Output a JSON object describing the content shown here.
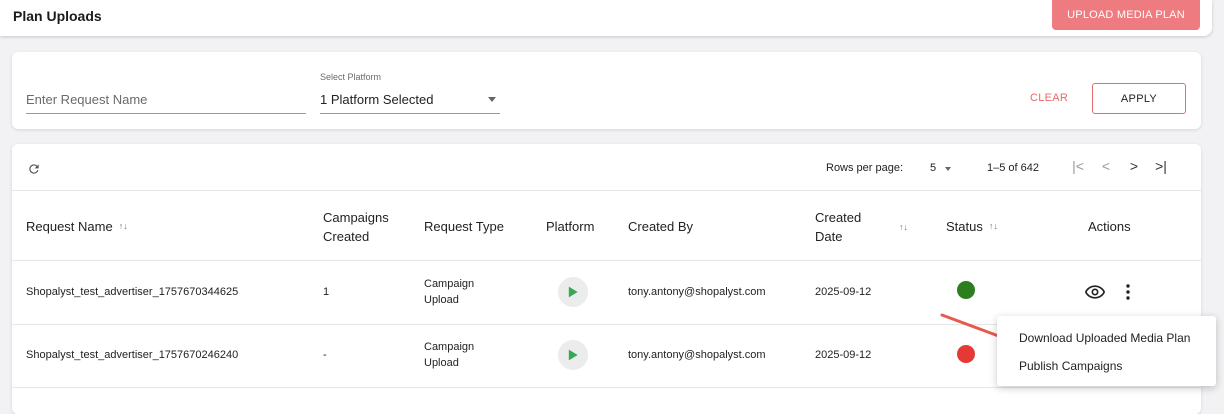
{
  "header": {
    "title": "Plan Uploads",
    "upload_button": "UPLOAD MEDIA PLAN"
  },
  "filters": {
    "request_name_placeholder": "Enter Request Name",
    "platform_label": "Select Platform",
    "platform_value": "1 Platform Selected",
    "clear_label": "CLEAR",
    "apply_label": "APPLY"
  },
  "pagination": {
    "rows_per_page_label": "Rows per page:",
    "rows_per_page_value": "5",
    "range": "1–5 of 642",
    "first_icon": "first-page-icon",
    "prev_icon": "chevron-left-icon",
    "next_icon": "chevron-right-icon",
    "last_icon": "last-page-icon"
  },
  "table": {
    "columns": {
      "request_name": "Request Name",
      "campaigns_created_1": "Campaigns",
      "campaigns_created_2": "Created",
      "request_type": "Request Type",
      "platform": "Platform",
      "created_by": "Created By",
      "created_date_1": "Created",
      "created_date_2": "Date",
      "status": "Status",
      "actions": "Actions"
    },
    "rows": [
      {
        "request_name": "Shopalyst_test_advertiser_1757670344625",
        "campaigns_created": "1",
        "request_type_1": "Campaign",
        "request_type_2": "Upload",
        "platform_icon": "google-play-icon",
        "created_by": "tony.antony@shopalyst.com",
        "created_date": "2025-09-12",
        "status_color": "#2e7d1f"
      },
      {
        "request_name": "Shopalyst_test_advertiser_1757670246240",
        "campaigns_created": "-",
        "request_type_1": "Campaign",
        "request_type_2": "Upload",
        "platform_icon": "google-play-icon",
        "created_by": "tony.antony@shopalyst.com",
        "created_date": "2025-09-12",
        "status_color": "#e53935"
      }
    ]
  },
  "actions_menu": {
    "items": [
      "Download Uploaded Media Plan",
      "Publish Campaigns"
    ]
  },
  "colors": {
    "accent": "#ee7b7f",
    "arrow": "#e85a50"
  }
}
